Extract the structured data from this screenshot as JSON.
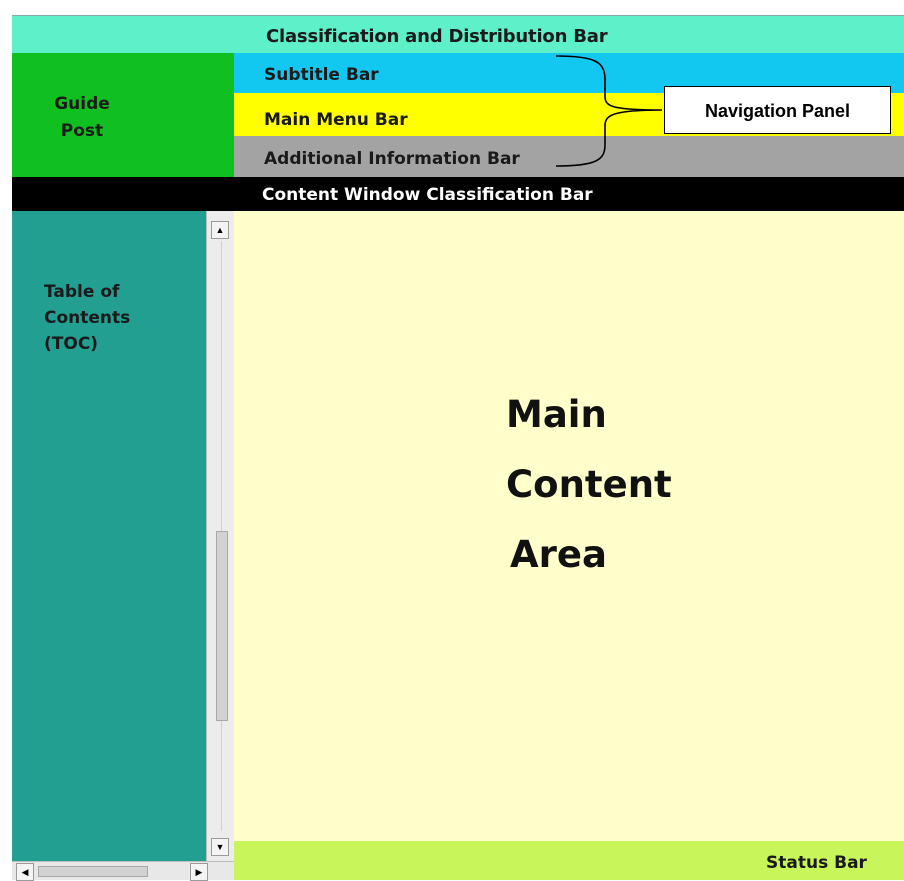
{
  "classification_bar": {
    "label": "Classification and Distribution Bar"
  },
  "guide_post": {
    "line1": "Guide",
    "line2": "Post"
  },
  "navigation_panel": {
    "callout_label": "Navigation Panel",
    "subtitle_bar": "Subtitle Bar",
    "main_menu_bar": "Main Menu Bar",
    "additional_info_bar": "Additional Information Bar"
  },
  "content_window_bar": {
    "label": "Content Window Classification Bar"
  },
  "toc": {
    "line1": "Table of",
    "line2": "Contents",
    "line3": "(TOC)"
  },
  "main_content": {
    "line1": "Main",
    "line2": "Content",
    "line3": "Area"
  },
  "status_bar": {
    "label": "Status Bar"
  },
  "colors": {
    "classification": "#5ef0c8",
    "guide_post": "#10c020",
    "subtitle": "#12c8f0",
    "main_menu": "#ffff00",
    "additional_info": "#a3a3a3",
    "content_window_bar": "#000000",
    "toc": "#239f92",
    "main_content": "#ffffcc",
    "status": "#c8f55a"
  },
  "icons": {
    "scroll_up": "▲",
    "scroll_down": "▼",
    "scroll_left": "◀",
    "scroll_right": "▶"
  }
}
